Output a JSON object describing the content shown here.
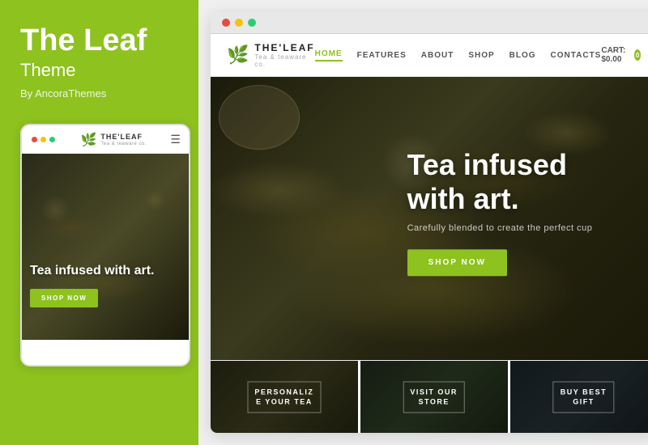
{
  "left": {
    "title": "The Leaf",
    "subtitle": "Theme",
    "author": "By AncoraThemes"
  },
  "mobile": {
    "dots": [
      {
        "color": "#e74c3c"
      },
      {
        "color": "#f1c40f"
      },
      {
        "color": "#2ecc71"
      }
    ],
    "logo_top": "THE'LEAF",
    "logo_sub": "Tea & teaware co.",
    "hero_text": "Tea infused with art.",
    "shop_btn": "SHOP NOW"
  },
  "browser": {
    "dots": [
      {
        "color": "#e74c3c"
      },
      {
        "color": "#f1c40f"
      },
      {
        "color": "#2ecc71"
      }
    ]
  },
  "site": {
    "logo": "THE'LEAF",
    "logo_sub": "Tea & teaware co.",
    "nav": [
      {
        "label": "HOME",
        "active": true
      },
      {
        "label": "FEATURES",
        "active": false
      },
      {
        "label": "ABOUT",
        "active": false
      },
      {
        "label": "SHOP",
        "active": false
      },
      {
        "label": "BLOG",
        "active": false
      },
      {
        "label": "CONTACTS",
        "active": false
      }
    ],
    "cart": "CART: $0.00",
    "cart_count": "0",
    "hero_title": "Tea infused\nwith art.",
    "hero_subtitle": "Carefully blended to create the perfect cup",
    "hero_btn": "SHOP NOW",
    "cards": [
      {
        "label": "PERSONALIZ\nE YOUR TEA"
      },
      {
        "label": "VISIT OUR\nSTORE"
      },
      {
        "label": "BUY BEST\nGIFT"
      }
    ]
  },
  "colors": {
    "accent": "#8dc21f",
    "white": "#ffffff",
    "dark": "#222222"
  }
}
